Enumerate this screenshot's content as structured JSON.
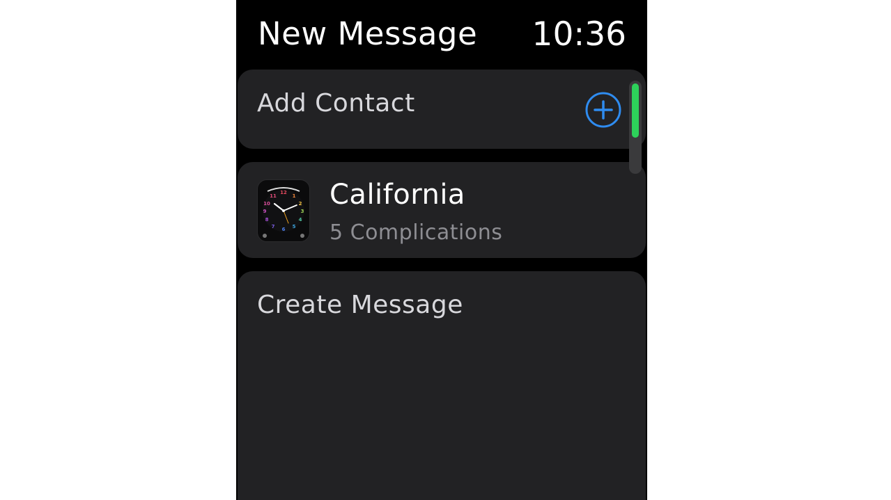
{
  "header": {
    "title": "New Message",
    "time": "10:36"
  },
  "add_contact": {
    "label": "Add Contact",
    "icon": "plus-circle-icon",
    "icon_color": "#2f8cf0"
  },
  "watch_face": {
    "name": "California",
    "subtitle": "5 Complications",
    "thumbnail": "california-watch-face-icon"
  },
  "create_message": {
    "label": "Create Message"
  },
  "scrollbar": {
    "position": 0,
    "thumb_color": "#2dd15a"
  },
  "colors": {
    "background": "#000000",
    "card": "#222224",
    "primary_text": "#ffffff",
    "secondary_text": "#8e8e93"
  }
}
